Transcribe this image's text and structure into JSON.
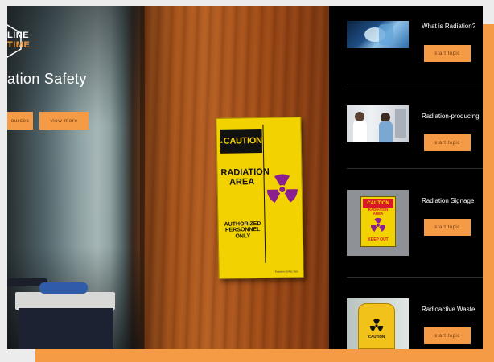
{
  "logo": {
    "line1": "LINE",
    "line2": "TIME"
  },
  "hero": {
    "title": "ation Safety",
    "buttons": [
      "ources",
      "view more"
    ]
  },
  "sign": {
    "header": "CAUTION",
    "line1": "RADIATION AREA",
    "line2": "AUTHORIZED PERSONNEL ONLY",
    "fine_print": "Radiation Safety Sign"
  },
  "topics": [
    {
      "title": "What is Radiation?",
      "button": "start topic",
      "thumb_icon": "radiation-equipment-thumb"
    },
    {
      "title": "Radiation-producing",
      "button": "start topic",
      "thumb_icon": "medical-imaging-thumb"
    },
    {
      "title": "Radiation Signage",
      "button": "start topic",
      "thumb_icon": "caution-sign-thumb",
      "thumb_sign": {
        "header": "CAUTION",
        "body": "RADIATION AREA",
        "footer": "KEEP OUT"
      }
    },
    {
      "title": "Radioactive Waste",
      "button": "start topic",
      "thumb_icon": "radioactive-barrel-thumb",
      "thumb_label": "CAUTION"
    }
  ],
  "colors": {
    "accent": "#f59a45",
    "sign_yellow": "#f2d200",
    "trefoil_purple": "#8a1f8f",
    "list_bg": "#000000"
  }
}
